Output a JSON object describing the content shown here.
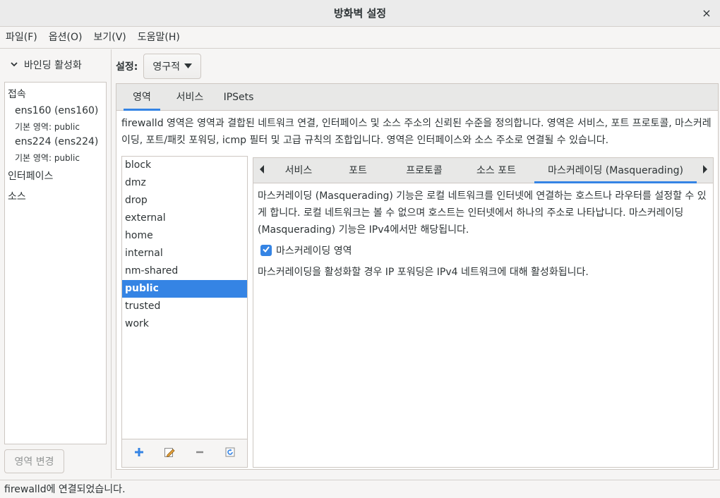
{
  "window": {
    "title": "방화벽 설정",
    "close_icon": "×"
  },
  "menu": [
    "파일(F)",
    "옵션(O)",
    "보기(V)",
    "도움말(H)"
  ],
  "sidebar": {
    "binding_label": "바인딩 활성화",
    "sections": {
      "connections": "접속",
      "interfaces": "인터페이스",
      "sources": "소스"
    },
    "connections": [
      {
        "device": "ens160 (ens160)",
        "zone": "기본 영역: public"
      },
      {
        "device": "ens224 (ens224)",
        "zone": "기본 영역: public"
      }
    ],
    "change_zone_button": "영역 변경"
  },
  "config": {
    "label": "설정:",
    "value": "영구적"
  },
  "main_tabs": [
    "영역",
    "서비스",
    "IPSets"
  ],
  "zones_description": "firewalld 영역은 영역과 결합된 네트워크 연결, 인터페이스 및 소스 주소의 신뢰된 수준을 정의합니다. 영역은 서비스, 포트 프로토콜, 마스커레이딩, 포트/패킷 포워딩, icmp 필터 및 고급 규칙의 조합입니다. 영역은 인터페이스와 소스 주소로 연결될 수 있습니다.",
  "zones": [
    "block",
    "dmz",
    "drop",
    "external",
    "home",
    "internal",
    "nm-shared",
    "public",
    "trusted",
    "work"
  ],
  "selected_zone": "public",
  "zone_tools": {
    "add": "+",
    "edit": "✎",
    "remove": "−",
    "reload": "↻"
  },
  "sub_tabs": [
    "서비스",
    "포트",
    "프로토콜",
    "소스 포트",
    "마스커레이딩 (Masquerading)"
  ],
  "masquerade": {
    "description": "마스커레이딩 (Masquerading) 기능은 로컬 네트워크를 인터넷에 연결하는 호스트나 라우터를 설정할 수 있게 합니다. 로컬 네트워크는 볼 수 없으며 호스트는 인터넷에서 하나의 주소로 나타납니다. 마스커레이딩 (Masquerading) 기능은 IPv4에서만 해당됩니다.",
    "checkbox_label": "마스커레이딩 영역",
    "checked": true,
    "note": "마스커레이딩을 활성화할 경우 IP 포워딩은 IPv4 네트워크에 대해 활성화됩니다."
  },
  "status": "firewalld에 연결되었습니다.",
  "colors": {
    "accent": "#3584e4",
    "icon_blue": "#3584e4",
    "icon_gray": "#8a8a8a"
  }
}
